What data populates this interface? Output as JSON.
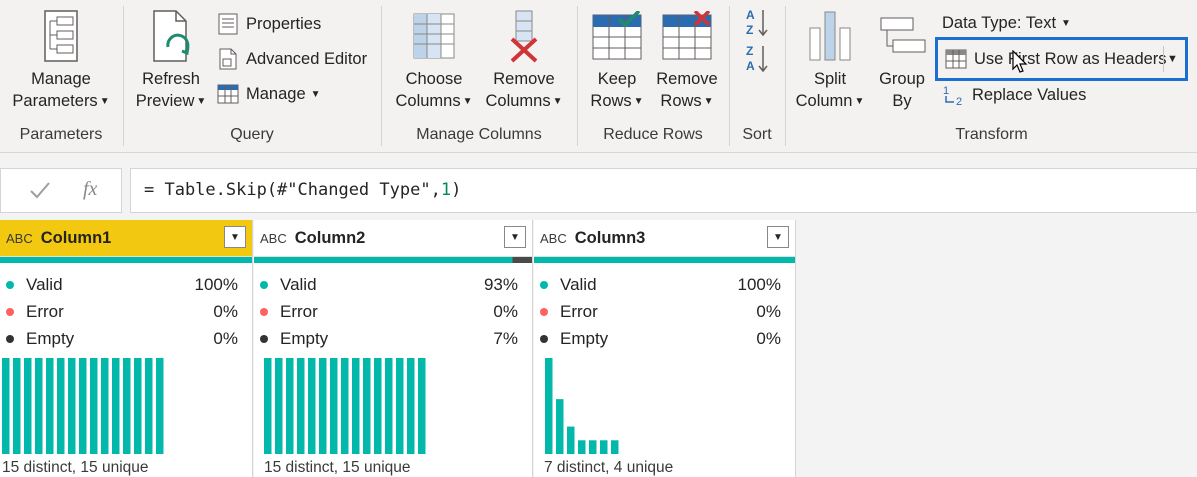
{
  "ribbon": {
    "parameters": {
      "manage_line1": "Manage",
      "manage_line2": "Parameters",
      "group_label": "Parameters"
    },
    "query": {
      "refresh_line1": "Refresh",
      "refresh_line2": "Preview",
      "properties": "Properties",
      "advanced_editor": "Advanced Editor",
      "manage": "Manage",
      "group_label": "Query"
    },
    "manage_columns": {
      "choose_line1": "Choose",
      "choose_line2": "Columns",
      "remove_line1": "Remove",
      "remove_line2": "Columns",
      "group_label": "Manage Columns"
    },
    "reduce_rows": {
      "keep_line1": "Keep",
      "keep_line2": "Rows",
      "remove_line1": "Remove",
      "remove_line2": "Rows",
      "group_label": "Reduce Rows"
    },
    "sort": {
      "group_label": "Sort"
    },
    "transform": {
      "split_line1": "Split",
      "split_line2": "Column",
      "group_line1": "Group",
      "group_line2": "By",
      "data_type": "Data Type: Text",
      "use_first_row": "Use First Row as Headers",
      "replace_values": "Replace Values",
      "group_label": "Transform"
    }
  },
  "formula": {
    "prefix": "= Table.Skip(#\"Changed Type\",",
    "number": "1",
    "suffix": ")"
  },
  "colors": {
    "valid": "#01b8aa",
    "error": "#fd625e",
    "empty": "#333333",
    "selected_header": "#f2c811",
    "highlight": "#1a6fd1"
  },
  "columns": [
    {
      "type_icon": "ABC",
      "name": "Column1",
      "selected": true,
      "stats": {
        "valid_label": "Valid",
        "valid": "100%",
        "error_label": "Error",
        "error": "0%",
        "empty_label": "Empty",
        "empty": "0%"
      },
      "valid_fraction": 1.0,
      "distribution": [
        1,
        1,
        1,
        1,
        1,
        1,
        1,
        1,
        1,
        1,
        1,
        1,
        1,
        1,
        1
      ],
      "footer": "15 distinct, 15 unique"
    },
    {
      "type_icon": "ABC",
      "name": "Column2",
      "selected": false,
      "stats": {
        "valid_label": "Valid",
        "valid": "93%",
        "error_label": "Error",
        "error": "0%",
        "empty_label": "Empty",
        "empty": "7%"
      },
      "valid_fraction": 0.93,
      "distribution": [
        1,
        1,
        1,
        1,
        1,
        1,
        1,
        1,
        1,
        1,
        1,
        1,
        1,
        1,
        1
      ],
      "footer": "15 distinct, 15 unique"
    },
    {
      "type_icon": "ABC",
      "name": "Column3",
      "selected": false,
      "stats": {
        "valid_label": "Valid",
        "valid": "100%",
        "error_label": "Error",
        "error": "0%",
        "empty_label": "Empty",
        "empty": "0%"
      },
      "valid_fraction": 1.0,
      "distribution": [
        7,
        4,
        2,
        1,
        1,
        1,
        1
      ],
      "footer": "7 distinct, 4 unique"
    }
  ]
}
